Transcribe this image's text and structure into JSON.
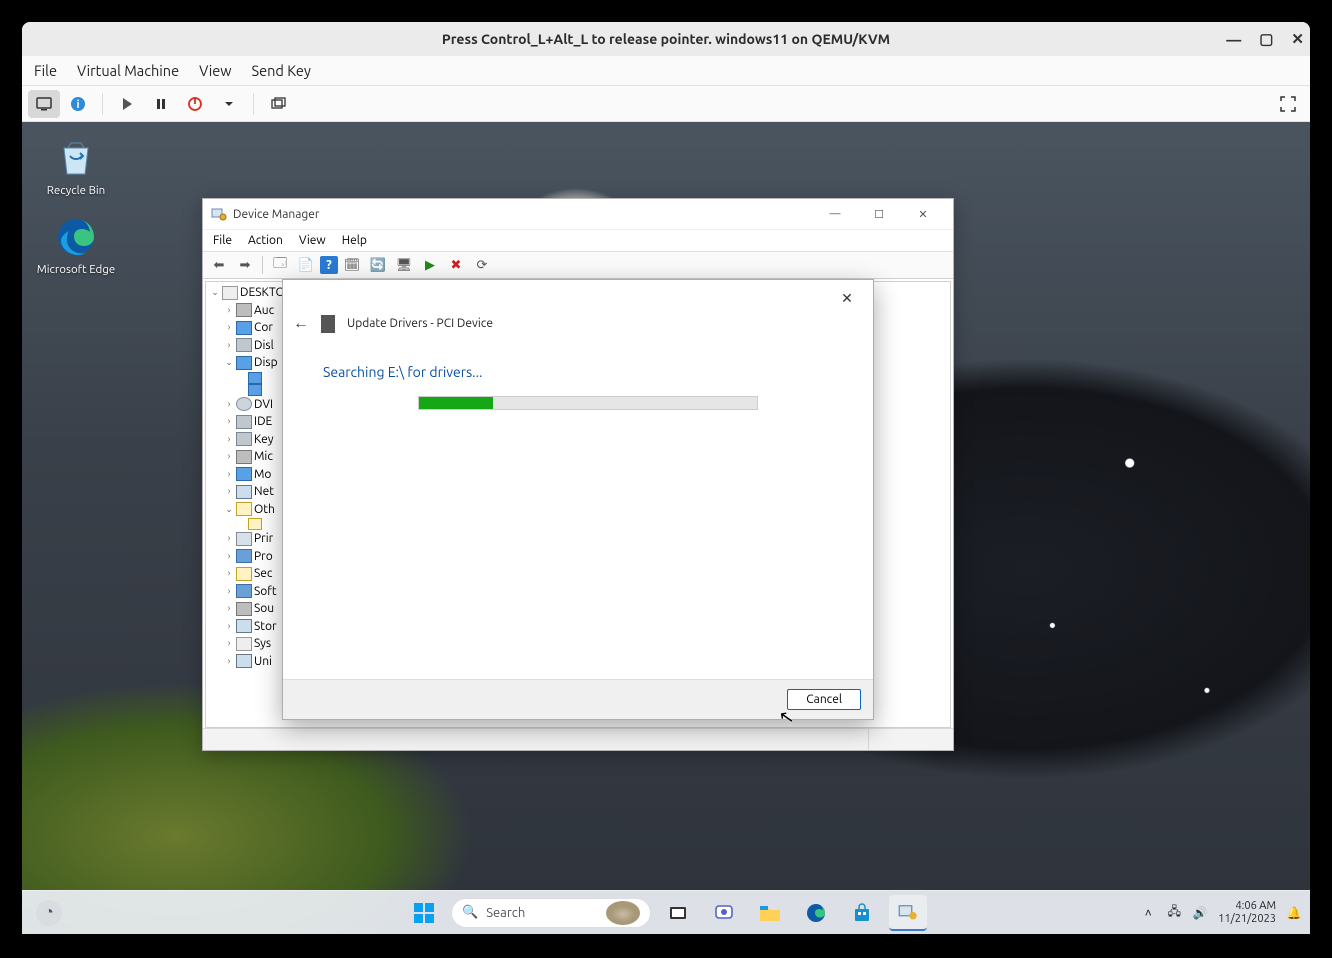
{
  "host": {
    "title": "Press Control_L+Alt_L to release pointer. windows11 on QEMU/KVM",
    "menu": {
      "file": "File",
      "vm": "Virtual Machine",
      "view": "View",
      "sendkey": "Send Key"
    }
  },
  "desktop": {
    "icons": {
      "recycle": "Recycle Bin",
      "edge": "Microsoft Edge"
    }
  },
  "dm": {
    "title": "Device Manager",
    "menu": {
      "file": "File",
      "action": "Action",
      "view": "View",
      "help": "Help"
    },
    "tree": {
      "root": "DESKTO",
      "items": [
        "Auc",
        "Cor",
        "Disl",
        "Disp",
        "DVI",
        "IDE",
        "Key",
        "Mic",
        "Mo",
        "Net",
        "Oth",
        "Prir",
        "Pro",
        "Sec",
        "Soft",
        "Sou",
        "Stor",
        "Sys",
        "Uni"
      ]
    }
  },
  "update": {
    "title": "Update Drivers - PCI Device",
    "message": "Searching E:\\ for drivers...",
    "cancel": "Cancel",
    "progress_pct": 22
  },
  "taskbar": {
    "search_placeholder": "Search",
    "time": "4:06 AM",
    "date": "11/21/2023"
  }
}
